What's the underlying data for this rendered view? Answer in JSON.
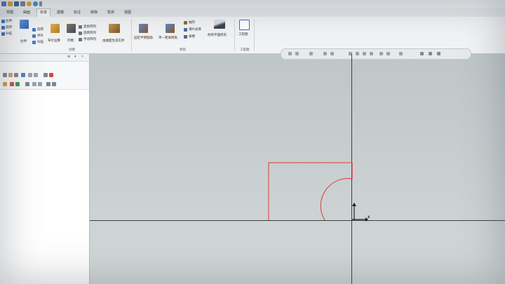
{
  "quick_access": {
    "icons": [
      "new-file-icon",
      "open-file-icon",
      "save-icon",
      "print-icon",
      "undo-icon",
      "redo-icon",
      "dropdown-icon"
    ]
  },
  "tabs": [
    {
      "label": "草图"
    },
    {
      "label": "曲面"
    },
    {
      "label": "实体"
    },
    {
      "label": "建模"
    },
    {
      "label": "标注"
    },
    {
      "label": "转换"
    },
    {
      "label": "机床"
    },
    {
      "label": "视图"
    }
  ],
  "ribbon": {
    "sketch_tools": [
      "拉伸",
      "旋转",
      "扫描"
    ],
    "extrude": "拉伸",
    "col2": [
      "旋转",
      "举升",
      "扫描"
    ],
    "boolean": "布尔运算",
    "imprint": "印模",
    "patterns": [
      "直角阵列",
      "旋转阵列",
      "手动阵列"
    ],
    "solid_from_surface": "由曲面生成实体",
    "fillet_fixed": "固定半倒圆角",
    "chamfer_single": "单一距离倒角",
    "modify_col": [
      "抽壳",
      "薄片加厚",
      "拔模"
    ],
    "split_plane": "依照平面修剪",
    "drawing": "工程图",
    "group_create": "创建",
    "group_modify": "修剪",
    "group_drawing": "工程图"
  },
  "panel": {
    "pin_icon": "pin-icon",
    "dropdown": "▾",
    "close": "×"
  },
  "viewport": {
    "axis_x": "x",
    "axis_y": "y"
  },
  "colors": {
    "sketch": "#e23a30",
    "axis": "#3c4046",
    "viewport_top": "#bfc6c8",
    "ribbon_bg": "#f2f3f4"
  }
}
